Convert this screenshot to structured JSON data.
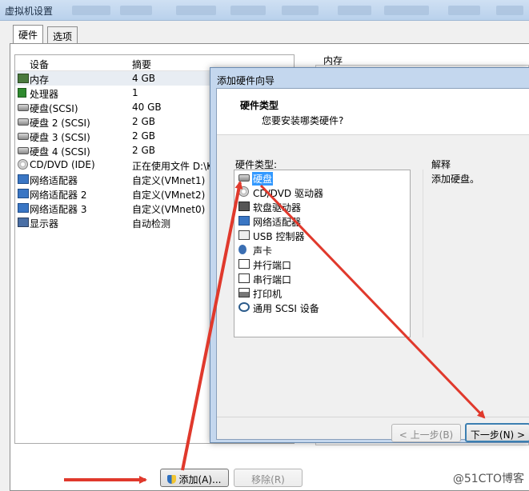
{
  "window": {
    "title": "虚拟机设置"
  },
  "tabs": [
    {
      "label": "硬件"
    },
    {
      "label": "选项"
    }
  ],
  "device_list": {
    "columns": [
      "设备",
      "摘要"
    ],
    "rows": [
      {
        "icon": "memory-icon",
        "name": "内存",
        "summary": "4 GB"
      },
      {
        "icon": "cpu-icon",
        "name": "处理器",
        "summary": "1"
      },
      {
        "icon": "harddisk-icon",
        "name": "硬盘(SCSI)",
        "summary": "40 GB"
      },
      {
        "icon": "harddisk-icon",
        "name": "硬盘 2 (SCSI)",
        "summary": "2 GB"
      },
      {
        "icon": "harddisk-icon",
        "name": "硬盘 3 (SCSI)",
        "summary": "2 GB"
      },
      {
        "icon": "harddisk-icon",
        "name": "硬盘 4 (SCSI)",
        "summary": "2 GB"
      },
      {
        "icon": "cd-icon",
        "name": "CD/DVD (IDE)",
        "summary": "正在使用文件 D:\\K"
      },
      {
        "icon": "network-icon",
        "name": "网络适配器",
        "summary": "自定义(VMnet1)"
      },
      {
        "icon": "network-icon",
        "name": "网络适配器 2",
        "summary": "自定义(VMnet2)"
      },
      {
        "icon": "network-icon",
        "name": "网络适配器 3",
        "summary": "自定义(VMnet0)"
      },
      {
        "icon": "monitor-icon",
        "name": "显示器",
        "summary": "自动检测"
      }
    ]
  },
  "right_panel": {
    "label": "内存"
  },
  "bottom_buttons": {
    "add": "添加(A)...",
    "remove": "移除(R)"
  },
  "wizard": {
    "title": "添加硬件向导",
    "header_title": "硬件类型",
    "header_subtitle": "您要安装哪类硬件?",
    "list_label": "硬件类型:",
    "items": [
      {
        "icon": "harddisk-icon",
        "label": "硬盘"
      },
      {
        "icon": "cd-icon",
        "label": "CD/DVD 驱动器"
      },
      {
        "icon": "floppy-icon",
        "label": "软盘驱动器"
      },
      {
        "icon": "network-icon",
        "label": "网络适配器"
      },
      {
        "icon": "usb-icon",
        "label": "USB 控制器"
      },
      {
        "icon": "sound-icon",
        "label": "声卡"
      },
      {
        "icon": "parallel-port-icon",
        "label": "并行端口"
      },
      {
        "icon": "serial-port-icon",
        "label": "串行端口"
      },
      {
        "icon": "printer-icon",
        "label": "打印机"
      },
      {
        "icon": "scsi-icon",
        "label": "通用 SCSI 设备"
      }
    ],
    "selected_item": "硬盘",
    "description_label": "解释",
    "description_text": "添加硬盘。",
    "back_button": "< 上一步(B)",
    "next_button": "下一步(N) >"
  },
  "watermark": "@51CTO博客",
  "colors": {
    "selection": "#3399ff",
    "arrow": "#e0392c",
    "title_bar": "#c4d7ee"
  }
}
